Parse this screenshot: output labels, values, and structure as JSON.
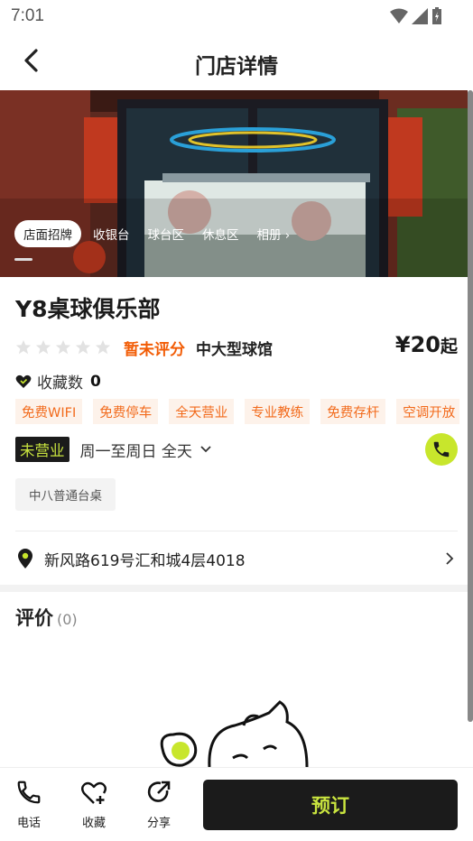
{
  "status_bar": {
    "time": "7:01"
  },
  "header": {
    "title": "门店详情"
  },
  "hero": {
    "tabs": [
      "店面招牌",
      "收银台",
      "球台区",
      "休息区",
      "相册 ›"
    ],
    "active_tab": 0
  },
  "store": {
    "name": "Y8桌球俱乐部",
    "rating_text": "暂未评分",
    "star_count": 5,
    "venue_type": "中大型球馆",
    "price": "¥20",
    "price_suffix": "起",
    "favorites_label": "收藏数",
    "favorites_count": "0",
    "tags": [
      "免费WIFI",
      "免费停车",
      "全天营业",
      "专业教练",
      "免费存杆",
      "空调开放"
    ],
    "status_badge": "未营业",
    "hours": "周一至周日 全天",
    "table_type": "中八普通台桌",
    "address": "新风路619号汇和城4层4018"
  },
  "reviews": {
    "title": "评价",
    "count": "(0)"
  },
  "bottom_bar": {
    "phone_label": "电话",
    "favorite_label": "收藏",
    "share_label": "分享",
    "book_label": "预订"
  },
  "colors": {
    "accent": "#c8e62c",
    "rating": "#f25c05",
    "tag_text": "#f26a1b",
    "dark": "#1b1b1b"
  }
}
